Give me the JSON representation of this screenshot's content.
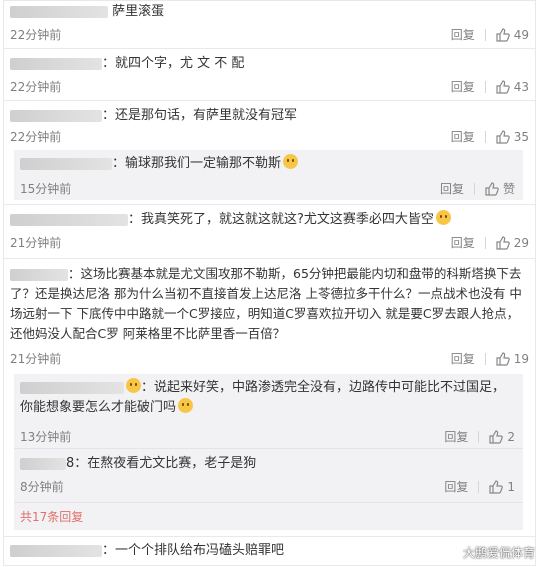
{
  "comments": [
    {
      "text": "萨里滚蛋",
      "time": "22分钟前",
      "reply": "回复",
      "likes": "49"
    },
    {
      "text": "：就四个字，尤 文 不 配",
      "time": "22分钟前",
      "reply": "回复",
      "likes": "43"
    },
    {
      "text": "：还是那句话，有萨里就没有冠军",
      "time": "22分钟前",
      "reply": "回复",
      "likes": "35"
    },
    {
      "text": "：我真笑死了，就这就这就这?尤文这赛季必四大皆空",
      "time": "21分钟前",
      "reply": "回复",
      "likes": "29"
    },
    {
      "text": "：这场比赛基本就是尤文围攻那不勒斯，65分钟把最能内切和盘带的科斯塔换下去了？还是换达尼洛 那为什么当初不直接首发上达尼洛 上苓德拉多干什么？一点战术也没有 中场远射一下 下底传中中路就一个C罗接应，明知道C罗喜欢拉开切入 就是要C罗去跟人抢点，还他妈没人配合C罗 阿莱格里不比萨里香一百倍？",
      "time": "21分钟前",
      "reply": "回复",
      "likes": "19"
    }
  ],
  "subreplies": [
    {
      "text": "：输球那我们一定输那不勒斯",
      "time": "15分钟前",
      "reply": "回复",
      "like_label": "赞"
    },
    {
      "text": "：说起来好笑，中路渗透完全没有，边路传中可能比不过国足，你能想象要怎么才能破门吗",
      "time": "13分钟前",
      "reply": "回复",
      "likes": "2"
    },
    {
      "text": "8：在熬夜看尤文比赛，老子是狗",
      "time": "8分钟前",
      "reply": "回复",
      "likes": "1"
    }
  ],
  "total_label": "共17条回复",
  "last_comment": {
    "text": "：一个个排队给布冯磕头赔罪吧"
  },
  "watermark": "大鹏爱侃体育",
  "colors": {
    "accent": "#e0706a",
    "subreply_bg": "#f2f2f5"
  }
}
